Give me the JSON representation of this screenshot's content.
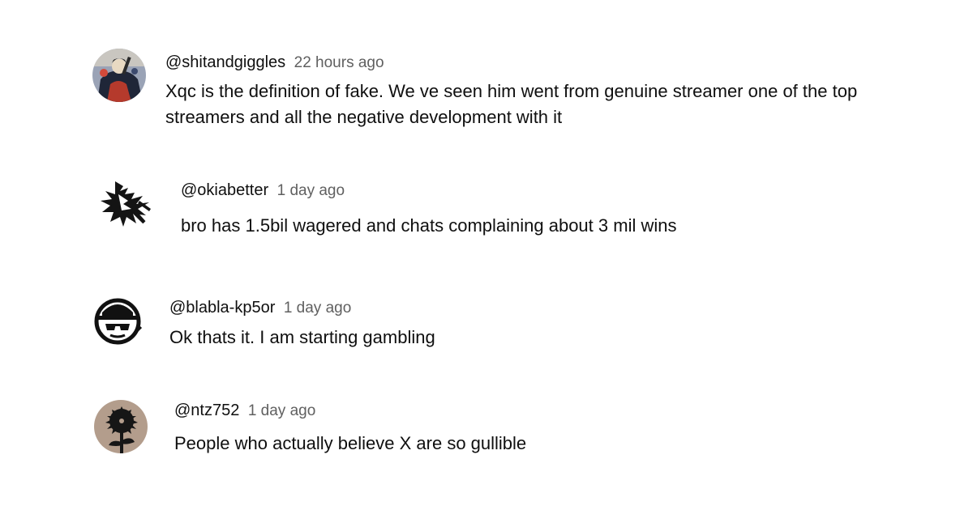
{
  "comments": [
    {
      "handle": "@shitandgiggles",
      "time": "22 hours ago",
      "text": "Xqc is the definition of fake. We ve seen him went from genuine streamer one of the top streamers and all the negative development with it",
      "avatar_icon": "samurai-painting-avatar-icon"
    },
    {
      "handle": "@okiabetter",
      "time": "1 day ago",
      "text": "bro has 1.5bil wagered and chats complaining about 3 mil wins",
      "avatar_icon": "black-ink-splash-avatar-icon"
    },
    {
      "handle": "@blabla-kp5or",
      "time": "1 day ago",
      "text": "Ok thats it. I am starting gambling",
      "avatar_icon": "hat-sunglasses-face-avatar-icon"
    },
    {
      "handle": "@ntz752",
      "time": "1 day ago",
      "text": "People who actually believe X are so gullible",
      "avatar_icon": "dark-flower-silhouette-avatar-icon"
    }
  ]
}
